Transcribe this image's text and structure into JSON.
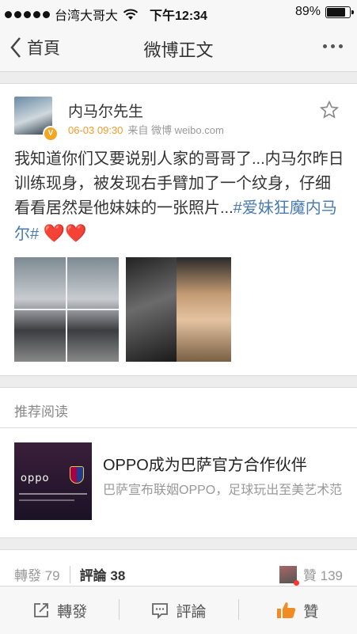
{
  "status": {
    "carrier": "台湾大哥大",
    "time": "下午12:34",
    "battery": "89%",
    "battery_level": 0.89
  },
  "nav": {
    "back_label": "首頁",
    "title": "微博正文"
  },
  "post": {
    "username": "内马尔先生",
    "time": "06-03 09:30",
    "source": "来自 微博 weibo.com",
    "text": "我知道你们又要说别人家的哥哥了...内马尔昨日训练现身，被发现右手臂加了一个纹身，仔细看看居然是他妹妹的一张照片...",
    "hashtag": "#爱妹狂魔内马尔#",
    "hearts": "❤️❤️"
  },
  "recommend": {
    "header": "推荐阅读",
    "title": "OPPO成为巴萨官方合作伙伴",
    "desc": "巴萨宣布联姻OPPO，足球玩出至美艺术范",
    "image_logo": "oppo"
  },
  "stats": {
    "reposts": "轉發 79",
    "comments": "評論 38",
    "likes": "贊 139"
  },
  "toolbar": {
    "repost": "轉發",
    "comment": "評論",
    "like": "贊"
  },
  "colors": {
    "accent": "#4a7bb0",
    "time": "#f59b2c",
    "like": "#f08c22"
  },
  "icons": {
    "back": "chevron-left-icon",
    "more": "more-icon",
    "star": "star-icon",
    "repost": "repost-icon",
    "comment": "comment-icon",
    "like": "thumbs-up-icon"
  }
}
